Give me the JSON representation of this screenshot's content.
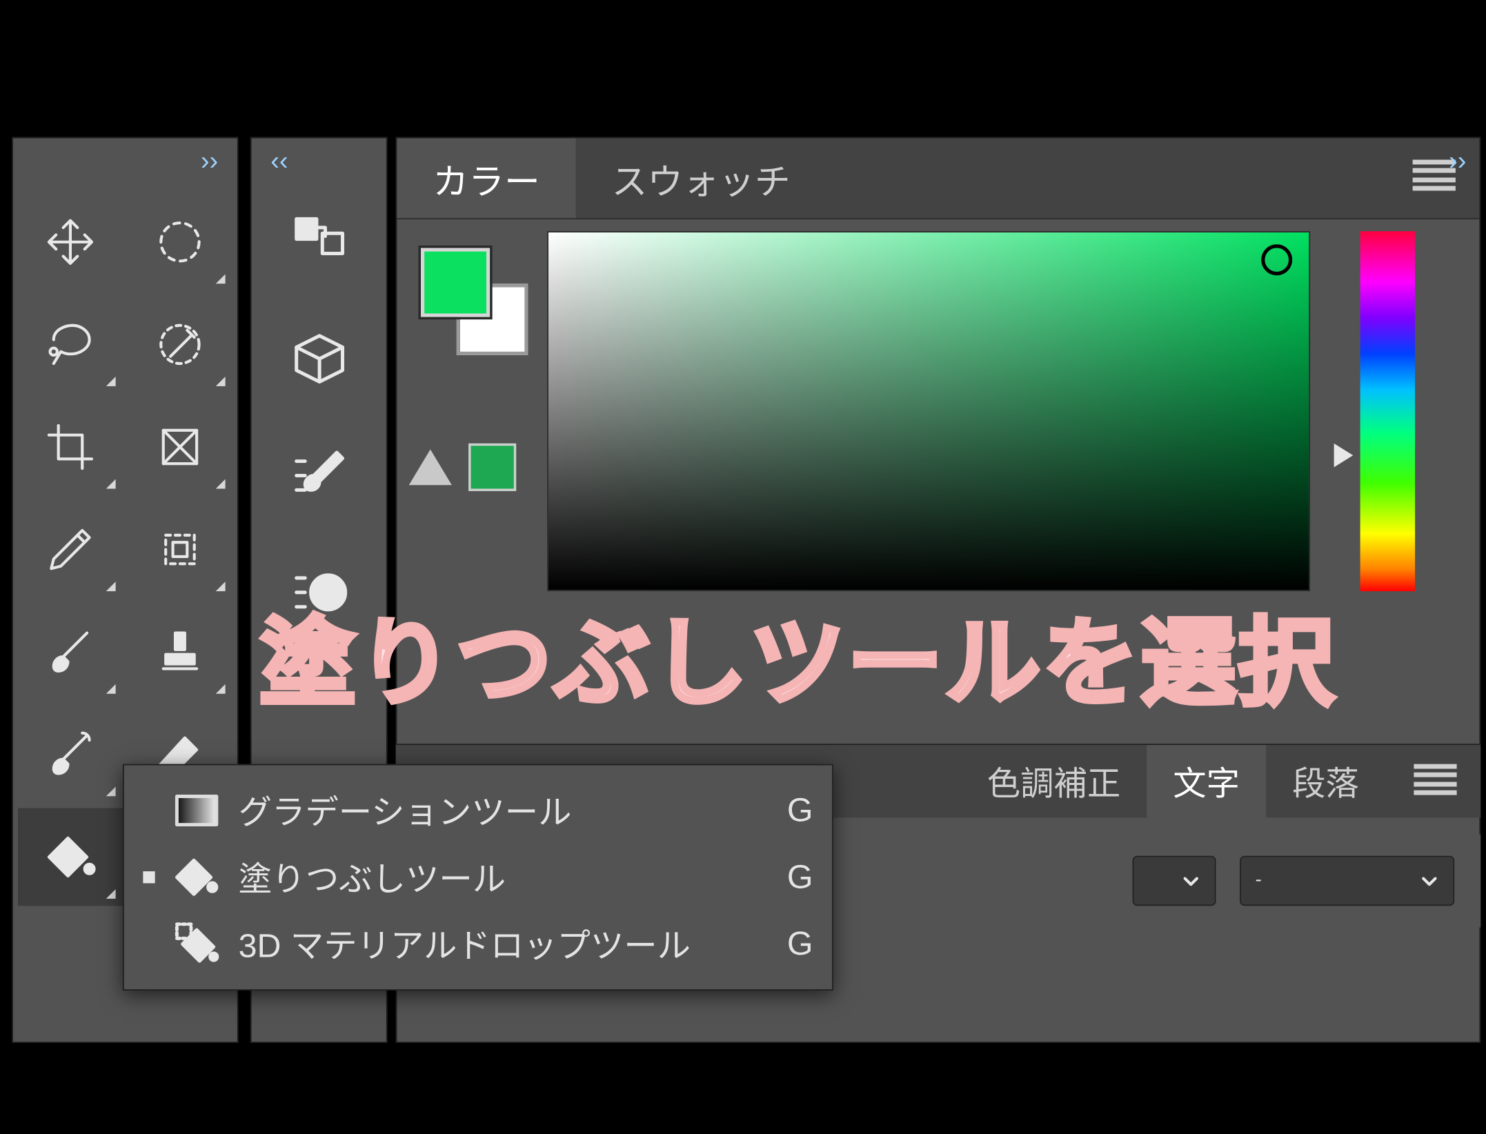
{
  "header": {
    "expand_main": "››",
    "collapse_side": "‹‹",
    "expand_right": "››"
  },
  "color_panel": {
    "tabs": [
      "カラー",
      "スウォッチ"
    ],
    "active_tab": 0,
    "foreground": "#0be060",
    "background": "#ffffff",
    "warning_swatch": "#1da851"
  },
  "lower_tabs": {
    "items": [
      "色調補正",
      "文字",
      "段落"
    ],
    "active": 1
  },
  "dropdowns": {
    "dd1": "",
    "dd2": "-"
  },
  "tools_main": [
    {
      "name": "move-tool"
    },
    {
      "name": "marquee-tool"
    },
    {
      "name": "lasso-tool"
    },
    {
      "name": "quick-select-tool"
    },
    {
      "name": "crop-tool"
    },
    {
      "name": "frame-tool"
    },
    {
      "name": "eyedropper-tool"
    },
    {
      "name": "patch-tool"
    },
    {
      "name": "brush-tool"
    },
    {
      "name": "stamp-tool"
    },
    {
      "name": "history-brush-tool"
    },
    {
      "name": "eraser-tool"
    },
    {
      "name": "fill-tool"
    }
  ],
  "flyout": {
    "items": [
      {
        "name": "gradient-tool",
        "label": "グラデーションツール",
        "shortcut": "G",
        "current": false
      },
      {
        "name": "paint-bucket-tool",
        "label": "塗りつぶしツール",
        "shortcut": "G",
        "current": true
      },
      {
        "name": "3d-material-drop-tool",
        "label": "3D マテリアルドロップツール",
        "shortcut": "G",
        "current": false
      }
    ]
  },
  "overlay": {
    "text": "塗りつぶしツールを選択"
  }
}
